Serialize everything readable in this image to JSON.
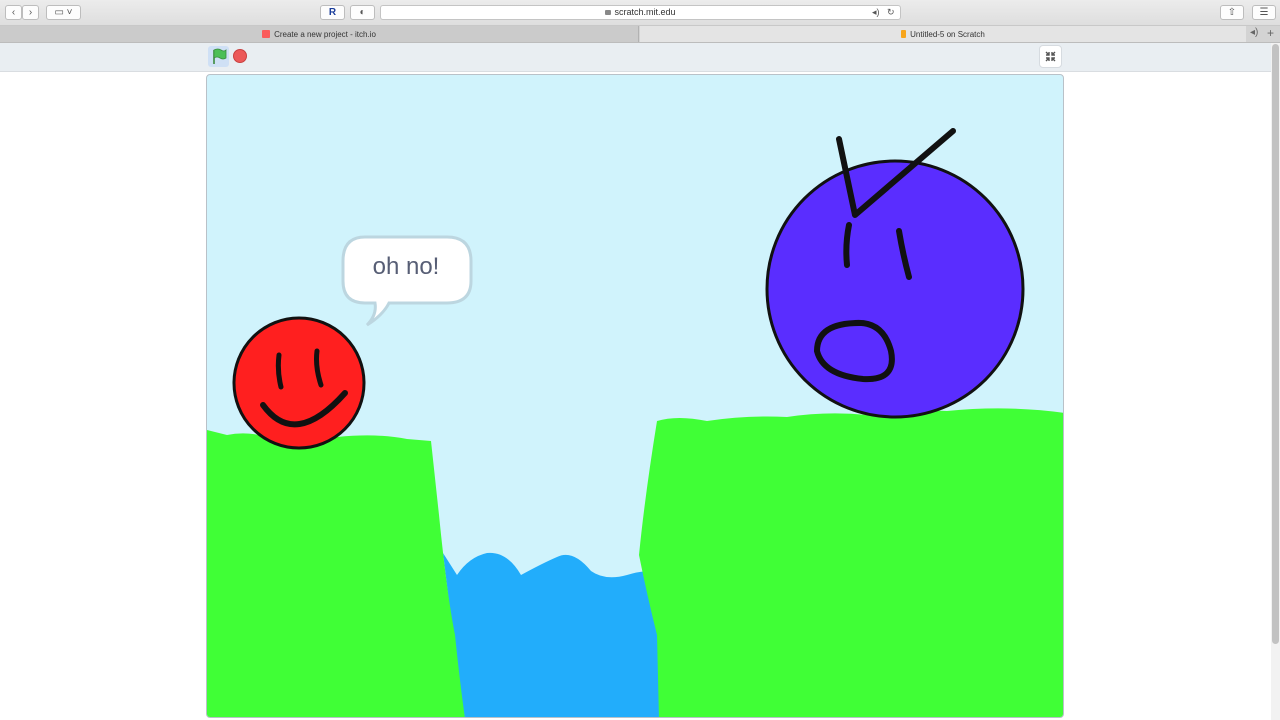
{
  "browser": {
    "url": "scratch.mit.edu",
    "tabs": [
      {
        "label": "Create a new project - itch.io",
        "favicon_color": "#fa5c5c",
        "active": false
      },
      {
        "label": "Untitled-5 on Scratch",
        "favicon_color": "#f7a51c",
        "active": true
      }
    ],
    "icons": {
      "back": "back-icon",
      "forward": "forward-icon",
      "sidebar": "sidebar-icon",
      "extension": "extension-icon",
      "reader": "reader-icon",
      "audio": "audio-icon",
      "reload": "reload-icon",
      "share": "share-icon",
      "tabs": "tabs-overview-icon",
      "new_tab": "new-tab-icon"
    }
  },
  "player": {
    "green_flag": "green-flag-icon",
    "stop": "stop-icon",
    "fullscreen": "exit-fullscreen-icon"
  },
  "stage": {
    "sky_color": "#d0f3fc",
    "speech_bubble": "oh no!",
    "sprites": [
      {
        "name": "red smiling ball",
        "color": "#ff1f1f"
      },
      {
        "name": "purple angry ball",
        "color": "#5a2dff"
      }
    ],
    "ground_color": "#40ff36",
    "water_color": "#22adfb"
  }
}
